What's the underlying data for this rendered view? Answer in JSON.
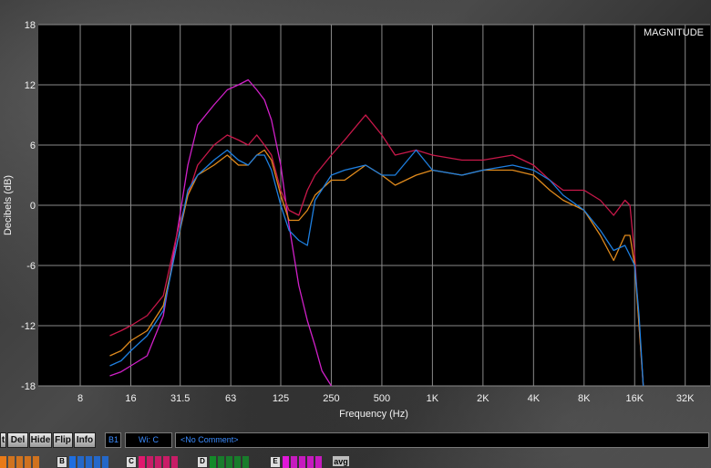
{
  "chart_data": {
    "type": "line",
    "title": "MAGNITUDE",
    "xlabel": "Frequency (Hz)",
    "ylabel": "Decibels (dB)",
    "x_scale": "log",
    "xlim": [
      4.5,
      45
    ],
    "ylim": [
      -18,
      18
    ],
    "x_ticks": [
      8,
      16,
      31.5,
      63,
      125,
      250,
      500,
      1000,
      2000,
      4000,
      8000,
      16000,
      32000
    ],
    "x_tick_labels": [
      "8",
      "16",
      "31.5",
      "63",
      "125",
      "250",
      "500",
      "1K",
      "2K",
      "4K",
      "8K",
      "16K",
      "32K"
    ],
    "y_ticks": [
      18,
      12,
      6,
      0,
      -6,
      -12,
      -18
    ],
    "y_tick_labels": [
      "18",
      "12",
      "6",
      "0",
      "-6",
      "-12",
      "-18"
    ],
    "grid": true,
    "series": [
      {
        "color": "#d020c8",
        "x": [
          12,
          14,
          16,
          20,
          25,
          30,
          35,
          40,
          50,
          60,
          70,
          80,
          90,
          100,
          110,
          125,
          140,
          160,
          180,
          200,
          220,
          250
        ],
        "y": [
          -17,
          -16.6,
          -16,
          -15,
          -11,
          -3,
          4,
          8,
          10,
          11.5,
          12,
          12.5,
          11.5,
          10.5,
          8.5,
          4,
          -2,
          -8,
          -11.5,
          -14,
          -16.5,
          -18
        ]
      },
      {
        "color": "#c8184a",
        "x": [
          12,
          14,
          16,
          20,
          25,
          30,
          35,
          40,
          50,
          60,
          70,
          80,
          90,
          100,
          110,
          125,
          140,
          160,
          180,
          200,
          250,
          300,
          400,
          500,
          600,
          800,
          1000,
          1500,
          2000,
          3000,
          4000,
          5000,
          6000,
          8000,
          10000,
          12000,
          14000,
          15000,
          16000,
          17000,
          18000
        ],
        "y": [
          -13,
          -12.5,
          -12,
          -11,
          -9,
          -3,
          1,
          4,
          6,
          7,
          6.5,
          6,
          7,
          6,
          5,
          1.5,
          -0.5,
          -1,
          1.5,
          3,
          5,
          6.5,
          9,
          7,
          5,
          5.5,
          5,
          4.5,
          4.5,
          5,
          4,
          2.5,
          1.5,
          1.5,
          0.5,
          -1,
          0.5,
          0,
          -5,
          -12,
          -18
        ]
      },
      {
        "color": "#e08a1c",
        "x": [
          12,
          14,
          16,
          20,
          25,
          30,
          35,
          40,
          50,
          60,
          70,
          80,
          90,
          100,
          110,
          125,
          140,
          160,
          180,
          200,
          250,
          300,
          400,
          500,
          600,
          800,
          1000,
          1500,
          2000,
          3000,
          4000,
          5000,
          6000,
          8000,
          10000,
          12000,
          14000,
          15000,
          16000,
          17000,
          18000
        ],
        "y": [
          -15,
          -14.5,
          -13.5,
          -12.5,
          -10,
          -4,
          1,
          3,
          4,
          5,
          4,
          4,
          5,
          5.5,
          4.5,
          1,
          -1.5,
          -1.5,
          -0.5,
          1,
          2.5,
          2.5,
          4,
          3,
          2,
          3,
          3.5,
          3,
          3.5,
          3.5,
          3,
          1.5,
          0.5,
          -0.5,
          -3,
          -5.5,
          -3,
          -3,
          -6,
          -12,
          -18
        ]
      },
      {
        "color": "#1e7fe0",
        "x": [
          12,
          14,
          16,
          20,
          25,
          30,
          35,
          40,
          50,
          60,
          70,
          80,
          90,
          100,
          110,
          125,
          140,
          160,
          180,
          200,
          250,
          300,
          400,
          500,
          600,
          800,
          1000,
          1500,
          2000,
          3000,
          4000,
          5000,
          6000,
          8000,
          10000,
          12000,
          14000,
          15000,
          16000,
          17000,
          18000
        ],
        "y": [
          -16,
          -15.5,
          -14.5,
          -13,
          -10.5,
          -4,
          1.5,
          3,
          4.5,
          5.5,
          4.5,
          4,
          5,
          5,
          3.5,
          0,
          -2.5,
          -3.5,
          -4,
          0.5,
          3,
          3.5,
          4,
          3,
          3,
          5.5,
          3.5,
          3,
          3.5,
          4,
          3.5,
          2.5,
          1,
          -0.5,
          -2.5,
          -4.5,
          -4,
          -5,
          -6,
          -11,
          -18
        ]
      }
    ]
  },
  "toolbar": {
    "buttons": [
      "t",
      "Del",
      "Hide",
      "Flip",
      "Info"
    ],
    "bank_label": "B1",
    "wi_label": "Wi: C",
    "comment": "<No Comment>"
  },
  "swatches": {
    "groups": [
      {
        "label": "",
        "color": "#e87a18"
      },
      {
        "label": "B",
        "color": "#1e6ee0"
      },
      {
        "label": "C",
        "color": "#e0186e"
      },
      {
        "label": "D",
        "color": "#148a2a"
      },
      {
        "label": "E",
        "color": "#e018d8"
      }
    ],
    "avg_label": "avg"
  }
}
